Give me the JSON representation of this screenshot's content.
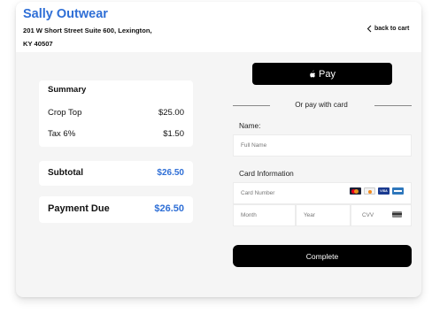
{
  "header": {
    "brand": "Sally Outwear",
    "address_line1": "201 W Short Street Suite 600, Lexington,",
    "address_line2": "KY 40507",
    "back_label": "back to cart"
  },
  "summary": {
    "title": "Summary",
    "items": [
      {
        "label": "Crop Top",
        "value": "$25.00"
      },
      {
        "label": "Tax 6%",
        "value": "$1.50"
      }
    ],
    "subtotal_label": "Subtotal",
    "subtotal_value": "$26.50",
    "payment_due_label": "Payment Due",
    "payment_due_value": "$26.50"
  },
  "payment": {
    "apple_pay_label": "Pay",
    "or_label": "Or pay with card",
    "name_label": "Name:",
    "full_name_placeholder": "Full Name",
    "card_info_label": "Card Information",
    "card_number_placeholder": "Card Number",
    "month_placeholder": "Month",
    "year_placeholder": "Year",
    "cvv_placeholder": "CVV",
    "card_brand_icons": [
      "mastercard-icon",
      "discover-icon",
      "visa-icon",
      "amex-icon"
    ],
    "visa_text": "VISA",
    "complete_label": "Complete"
  },
  "colors": {
    "brand": "#2f6fd6",
    "button_bg": "#000000",
    "page_bg": "#f5f5f5"
  }
}
